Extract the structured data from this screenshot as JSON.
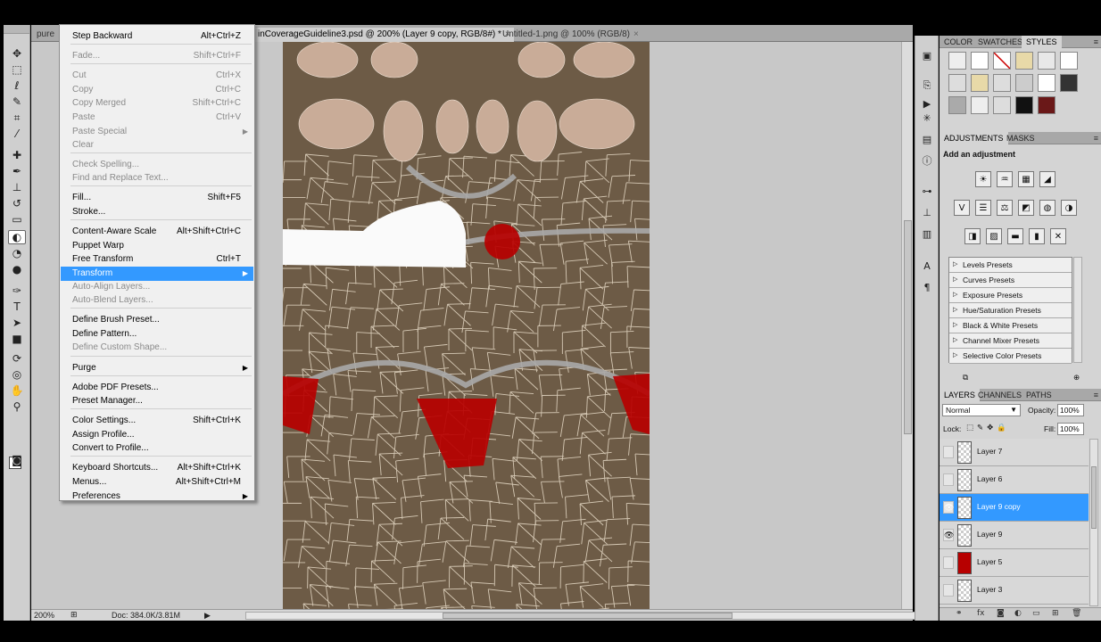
{
  "tabs": [
    {
      "label": "pure",
      "active": false
    },
    {
      "label": "inCoverageGuideline3.psd @ 200% (Layer 9 copy, RGB/8#) *",
      "active": true
    },
    {
      "label": "Untitled-1.png @ 100% (RGB/8)",
      "active": false
    }
  ],
  "edit_menu": [
    {
      "label": "Step Backward",
      "shortcut": "Alt+Ctrl+Z",
      "disabled": false
    },
    {
      "label": "Fade...",
      "shortcut": "Shift+Ctrl+F",
      "disabled": true
    },
    {
      "label": "Cut",
      "shortcut": "Ctrl+X",
      "disabled": true
    },
    {
      "label": "Copy",
      "shortcut": "Ctrl+C",
      "disabled": true
    },
    {
      "label": "Copy Merged",
      "shortcut": "Shift+Ctrl+C",
      "disabled": true
    },
    {
      "label": "Paste",
      "shortcut": "Ctrl+V",
      "disabled": true
    },
    {
      "label": "Paste Special",
      "shortcut": "",
      "disabled": true,
      "submenu": true
    },
    {
      "label": "Clear",
      "shortcut": "",
      "disabled": true
    },
    {
      "label": "Check Spelling...",
      "shortcut": "",
      "disabled": true
    },
    {
      "label": "Find and Replace Text...",
      "shortcut": "",
      "disabled": true
    },
    {
      "label": "Fill...",
      "shortcut": "Shift+F5",
      "disabled": false
    },
    {
      "label": "Stroke...",
      "shortcut": "",
      "disabled": false
    },
    {
      "label": "Content-Aware Scale",
      "shortcut": "Alt+Shift+Ctrl+C",
      "disabled": false
    },
    {
      "label": "Puppet Warp",
      "shortcut": "",
      "disabled": false
    },
    {
      "label": "Free Transform",
      "shortcut": "Ctrl+T",
      "disabled": false
    },
    {
      "label": "Transform",
      "shortcut": "",
      "disabled": false,
      "submenu": true,
      "highlight": true
    },
    {
      "label": "Auto-Align Layers...",
      "shortcut": "",
      "disabled": true
    },
    {
      "label": "Auto-Blend Layers...",
      "shortcut": "",
      "disabled": true
    },
    {
      "label": "Define Brush Preset...",
      "shortcut": "",
      "disabled": false
    },
    {
      "label": "Define Pattern...",
      "shortcut": "",
      "disabled": false
    },
    {
      "label": "Define Custom Shape...",
      "shortcut": "",
      "disabled": true
    },
    {
      "label": "Purge",
      "shortcut": "",
      "disabled": false,
      "submenu": true
    },
    {
      "label": "Adobe PDF Presets...",
      "shortcut": "",
      "disabled": false
    },
    {
      "label": "Preset Manager...",
      "shortcut": "",
      "disabled": false
    },
    {
      "label": "Color Settings...",
      "shortcut": "Shift+Ctrl+K",
      "disabled": false
    },
    {
      "label": "Assign Profile...",
      "shortcut": "",
      "disabled": false
    },
    {
      "label": "Convert to Profile...",
      "shortcut": "",
      "disabled": false
    },
    {
      "label": "Keyboard Shortcuts...",
      "shortcut": "Alt+Shift+Ctrl+K",
      "disabled": false
    },
    {
      "label": "Menus...",
      "shortcut": "Alt+Shift+Ctrl+M",
      "disabled": false
    },
    {
      "label": "Preferences",
      "shortcut": "",
      "disabled": false,
      "submenu": true
    }
  ],
  "styles_panel": {
    "tabs": [
      "COLOR",
      "SWATCHES",
      "STYLES"
    ],
    "active_tab": "STYLES",
    "menu_glyph": "≡"
  },
  "adjustments_panel": {
    "tabs": [
      "ADJUSTMENTS",
      "MASKS"
    ],
    "active_tab": "ADJUSTMENTS",
    "title": "Add an adjustment",
    "presets": [
      "Levels Presets",
      "Curves Presets",
      "Exposure Presets",
      "Hue/Saturation Presets",
      "Black & White Presets",
      "Channel Mixer Presets",
      "Selective Color Presets"
    ]
  },
  "layers_panel": {
    "tabs": [
      "LAYERS",
      "CHANNELS",
      "PATHS"
    ],
    "active_tab": "LAYERS",
    "blend_mode": "Normal",
    "opacity_label": "Opacity:",
    "opacity": "100%",
    "lock_label": "Lock:",
    "fill_label": "Fill:",
    "fill": "100%",
    "layers": [
      {
        "name": "Layer 7",
        "visible": false,
        "selected": false,
        "thumb": "transparent"
      },
      {
        "name": "Layer 6",
        "visible": false,
        "selected": false,
        "thumb": "transparent"
      },
      {
        "name": "Layer 9 copy",
        "visible": true,
        "selected": true,
        "thumb": "transparent"
      },
      {
        "name": "Layer 9",
        "visible": true,
        "selected": false,
        "thumb": "transparent"
      },
      {
        "name": "Layer 5",
        "visible": false,
        "selected": false,
        "thumb": "red"
      },
      {
        "name": "Layer 3",
        "visible": false,
        "selected": false,
        "thumb": "transparent"
      }
    ]
  },
  "status": {
    "zoom": "200%",
    "doc": "Doc: 384.0K/3.81M"
  },
  "colors": {
    "highlight": "#3399ff",
    "texture_bg": "#6d5b46",
    "mesh": "#e8dcc8",
    "red": "#b70000"
  }
}
